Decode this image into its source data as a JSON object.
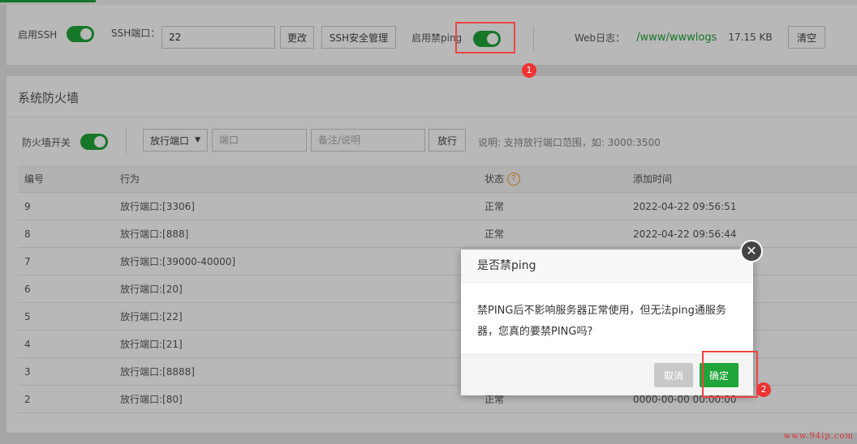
{
  "ssh": {
    "enable_ssh_label": "启用SSH",
    "port_label": "SSH端口：",
    "port_value": "22",
    "change_button": "更改",
    "security_button": "SSH安全管理",
    "ping_label": "启用禁ping",
    "weblog_label": "Web日志：",
    "weblog_path": "/www/wwwlogs",
    "weblog_size": "17.15 KB",
    "clear_button": "清空"
  },
  "firewall": {
    "title": "系统防火墙",
    "switch_label": "防火墙开关",
    "type_select": "放行端口",
    "port_placeholder": "端口",
    "note_placeholder": "备注/说明",
    "allow_button": "放行",
    "hint": "说明: 支持放行端口范围，如: 3000:3500",
    "columns": [
      "编号",
      "行为",
      "状态",
      "添加时间"
    ],
    "rows": [
      {
        "id": "9",
        "action": "放行端口:[3306]",
        "status": "正常",
        "time": "2022-04-22 09:56:51"
      },
      {
        "id": "8",
        "action": "放行端口:[888]",
        "status": "正常",
        "time": "2022-04-22 09:56:44"
      },
      {
        "id": "7",
        "action": "放行端口:[39000-40000]",
        "status": "",
        "time": ""
      },
      {
        "id": "6",
        "action": "放行端口:[20]",
        "status": "",
        "time": ""
      },
      {
        "id": "5",
        "action": "放行端口:[22]",
        "status": "",
        "time": ""
      },
      {
        "id": "4",
        "action": "放行端口:[21]",
        "status": "",
        "time": ""
      },
      {
        "id": "3",
        "action": "放行端口:[8888]",
        "status": "",
        "time": ""
      },
      {
        "id": "2",
        "action": "放行端口:[80]",
        "status": "正常",
        "time": "0000-00-00 00:00:00"
      }
    ]
  },
  "dialog": {
    "title": "是否禁ping",
    "message": "禁PING后不影响服务器正常使用，但无法ping通服务器，您真的要禁PING吗?",
    "cancel": "取消",
    "confirm": "确定",
    "close_icon": "close-icon"
  },
  "annotations": {
    "badge1": "1",
    "badge2": "2"
  },
  "watermark": "www.94ip.com",
  "colors": {
    "accent": "#20a53a",
    "highlight": "#e44444",
    "help": "#f39b1a"
  }
}
